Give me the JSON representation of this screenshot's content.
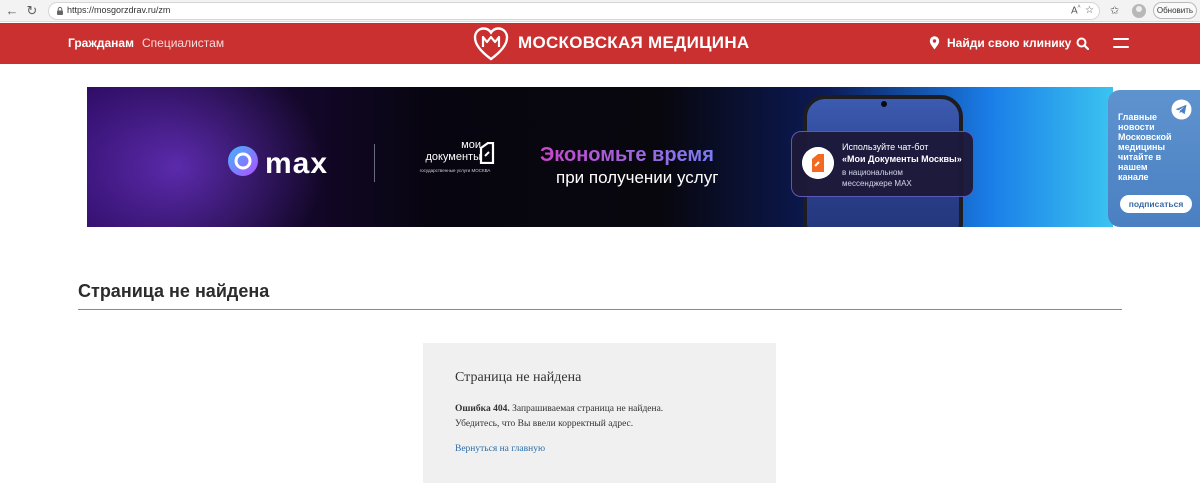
{
  "browser": {
    "url": "https://mosgorzdrav.ru/zm",
    "refresh_label": "Обновить",
    "reader_label": "AA"
  },
  "header": {
    "nav_citizens": "Гражданам",
    "nav_specialists": "Специалистам",
    "logo_text": "МОСКОВСКАЯ МЕДИЦИНА",
    "find_clinic": "Найди свою клинику",
    "colors": {
      "brand_red": "#c9302f"
    }
  },
  "banner": {
    "max_text": "max",
    "docs_title": "мои документы",
    "docs_sub": "государственные услуги МОСКВА",
    "headline_1": "Экономьте время",
    "headline_2": "при получении услуг",
    "bubble_1": "Используйте чат-бот",
    "bubble_2": "«Мои Документы Москвы»",
    "bubble_3": "в национальном",
    "bubble_4": "мессенджере MAX"
  },
  "telegram_widget": {
    "text": "Главные новости Московской медицины читайте в нашем канале",
    "button": "подписаться"
  },
  "main": {
    "page_title": "Страница не найдена",
    "card_heading": "Страница не найдена",
    "error_code": "Ошибка 404.",
    "error_text": "Запрашиваемая страница не найдена.",
    "error_hint": "Убедитесь, что Вы ввели корректный адрес.",
    "back_link": "Вернуться на главную"
  }
}
